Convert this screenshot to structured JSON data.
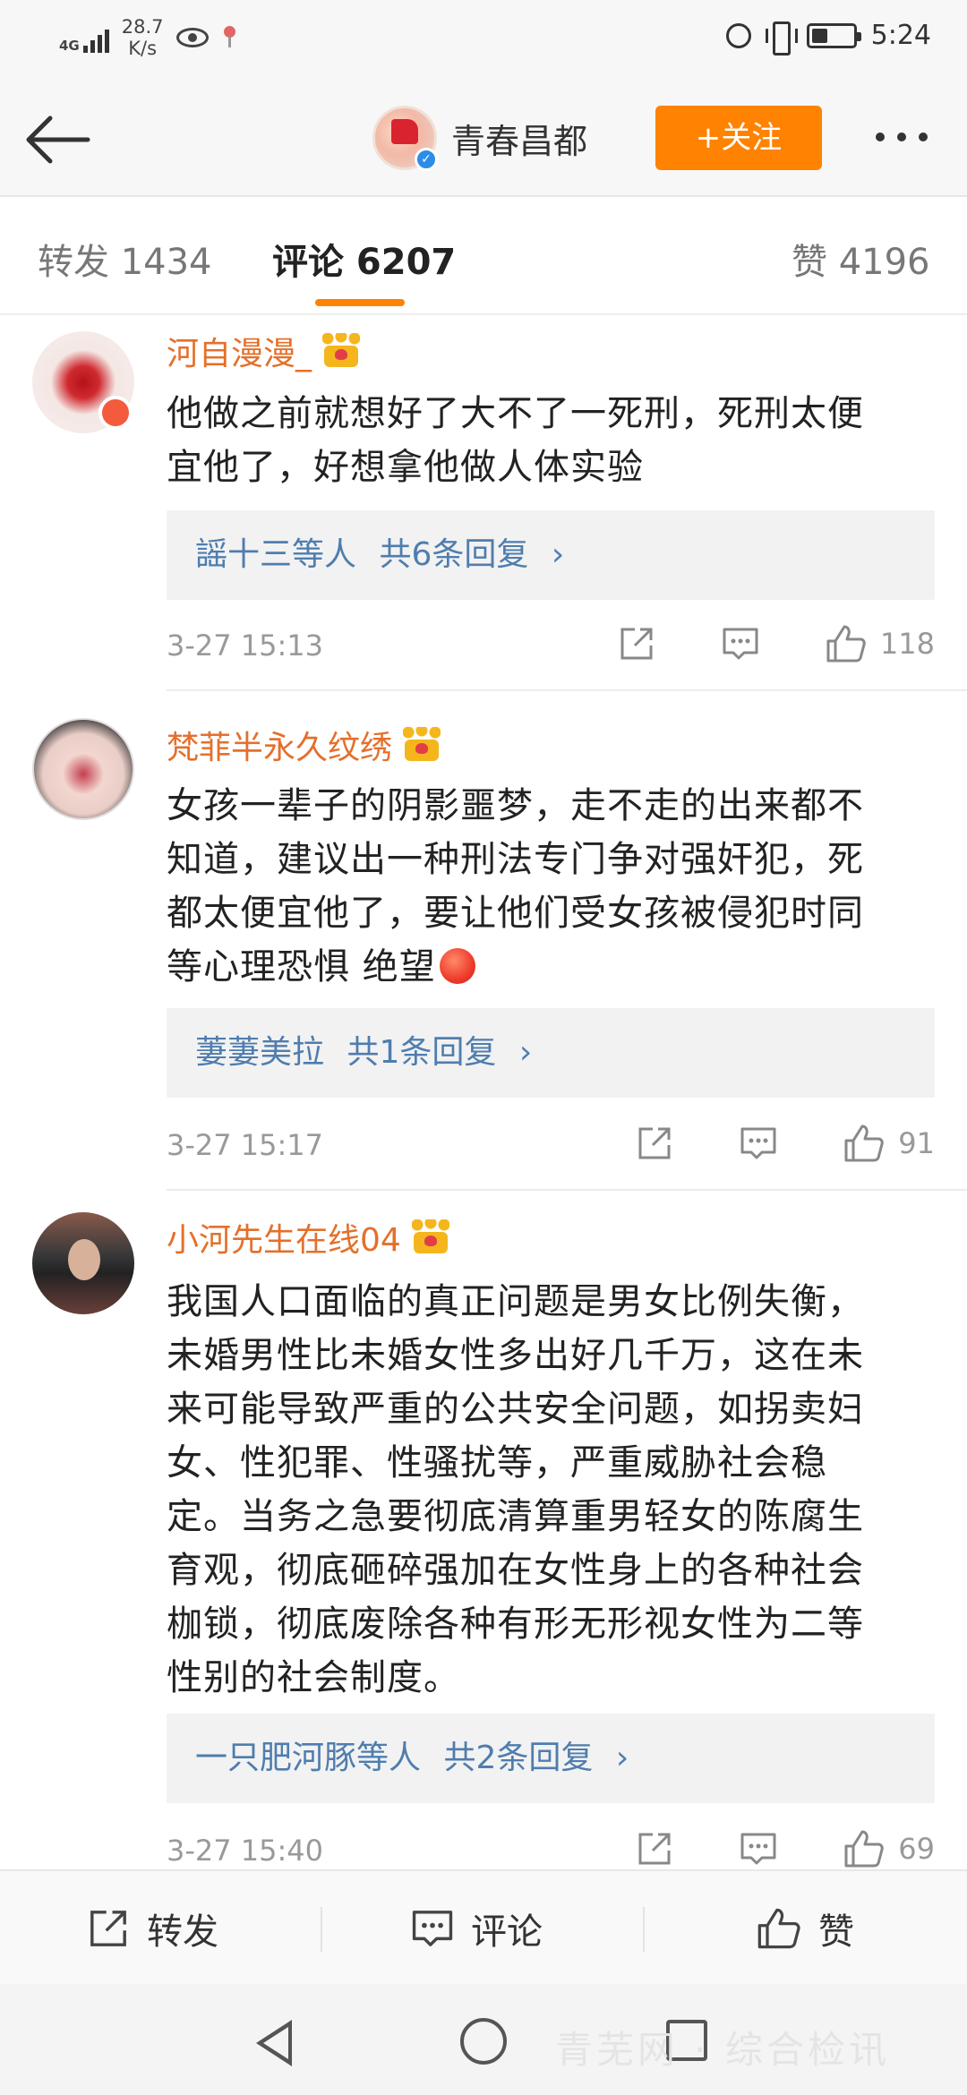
{
  "status_bar": {
    "network": "4G",
    "speed_value": "28.7",
    "speed_unit": "K/s",
    "time": "5:24",
    "icons": [
      "signal-icon",
      "eye-icon",
      "location-icon",
      "alarm-icon",
      "vibrate-icon",
      "battery-icon"
    ]
  },
  "header": {
    "account_name": "青春昌都",
    "follow_label": "+关注",
    "accent": "#ff8200"
  },
  "tabs": {
    "repost_label": "转发 1434",
    "comment_label": "评论 6207",
    "like_label": "赞 4196",
    "active": "comment"
  },
  "comments": [
    {
      "username": "河自漫漫_",
      "lines": [
        "他做之前就想好了大不了一死刑，死刑太便",
        "宜他了，好想拿他做人体实验"
      ],
      "replies_by": "謡十三等人",
      "replies_count": "共6条回复",
      "time": "3-27 15:13",
      "likes": "118"
    },
    {
      "username": "梵菲半永久纹绣",
      "lines": [
        "女孩一辈子的阴影噩梦，走不走的出来都不",
        "知道，建议出一种刑法专门争对强奸犯，死",
        "都太便宜他了，要让他们受女孩被侵犯时同",
        "等心理恐惧 绝望"
      ],
      "replies_by": "萋萋美拉",
      "replies_count": "共1条回复",
      "time": "3-27 15:17",
      "likes": "91"
    },
    {
      "username": "小河先生在线04",
      "lines": [
        "我国人口面临的真正问题是男女比例失衡，",
        "未婚男性比未婚女性多出好几千万，这在未",
        "来可能导致严重的公共安全问题，如拐卖妇",
        "女、性犯罪、性骚扰等，严重威胁社会稳",
        "定。当务之急要彻底清算重男轻女的陈腐生",
        "育观，彻底砸碎强加在女性身上的各种社会",
        "枷锁，彻底废除各种有形无形视女性为二等",
        "性别的社会制度。"
      ],
      "replies_by": "一只肥河豚等人",
      "replies_count": "共2条回复",
      "time": "3-27 15:40",
      "likes": "69"
    }
  ],
  "action_bar": {
    "repost": "转发",
    "comment": "评论",
    "like": "赞"
  },
  "watermark": "青芜网 · 综合检讯",
  "colors": {
    "username": "#e4702b",
    "reply_link": "#4f7dae",
    "meta": "#999999"
  }
}
